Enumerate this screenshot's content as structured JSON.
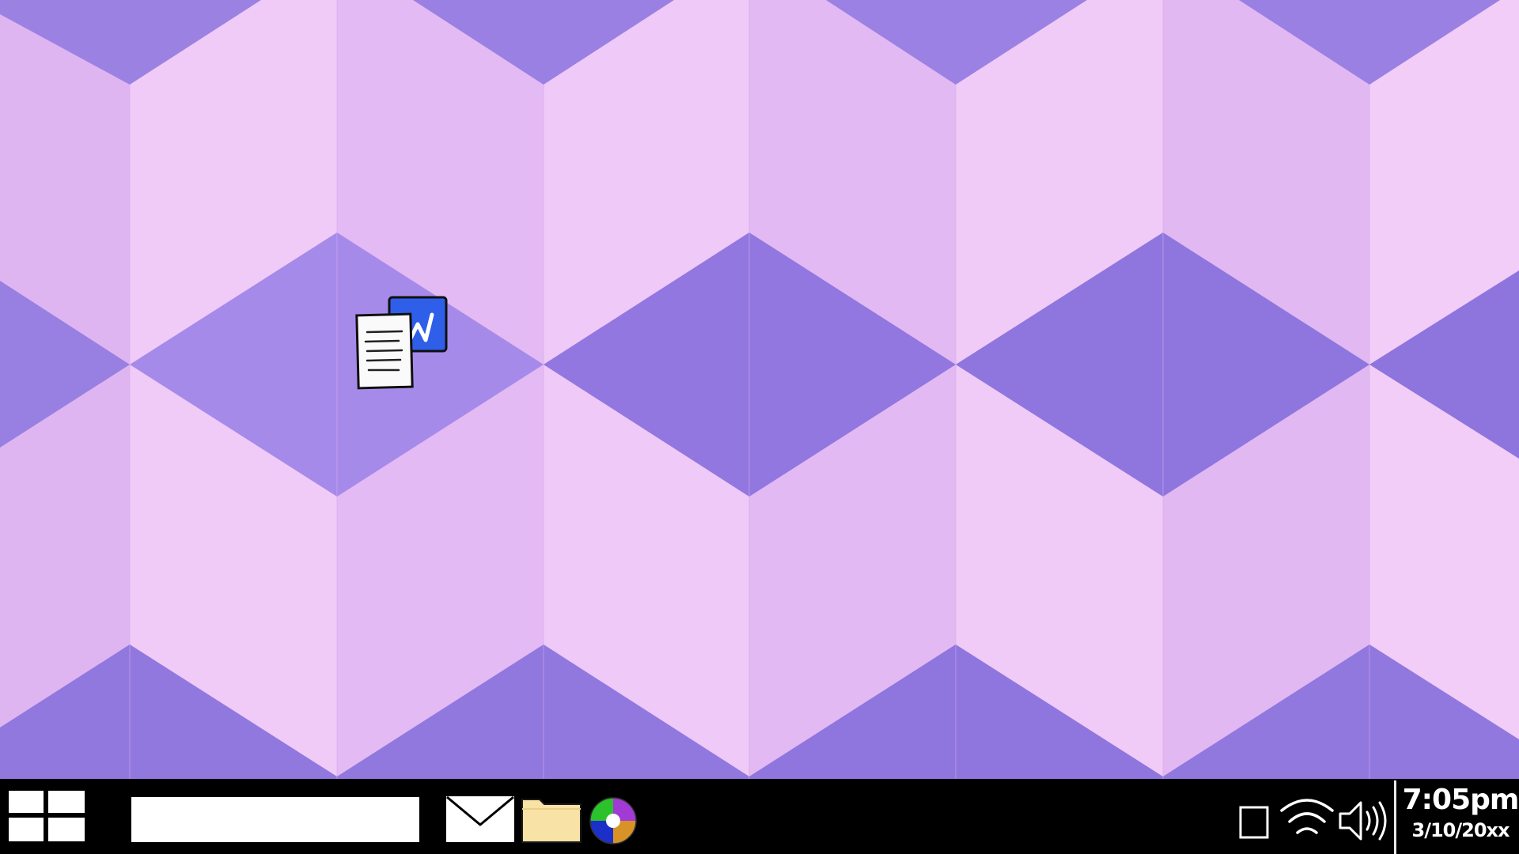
{
  "desktop": {
    "wallpaper": {
      "name": "purple-hexagon-cubes",
      "colors": {
        "light": "#f1ccf8",
        "mid": "#dcb1ef",
        "dark": "#9278e0"
      }
    },
    "icons": [
      {
        "name": "document-shortcut-icon",
        "icon": "document-with-word-badge"
      }
    ]
  },
  "taskbar": {
    "background": "#000000",
    "start_icon": "windows-start-icon",
    "search": {
      "value": "",
      "placeholder": ""
    },
    "pinned": [
      {
        "name": "mail",
        "icon": "envelope-icon"
      },
      {
        "name": "file-explorer",
        "icon": "folder-icon",
        "color": "#f8e2a6"
      },
      {
        "name": "color-app",
        "icon": "color-wheel-icon",
        "colors": [
          "#2cc22c",
          "#a23ad6",
          "#d89326",
          "#1c2fc8"
        ]
      }
    ],
    "tray": {
      "icons": [
        "notification-square-icon",
        "wifi-icon",
        "volume-icon"
      ]
    },
    "clock": {
      "time": "7:05pm",
      "date": "3/10/20xx"
    }
  }
}
